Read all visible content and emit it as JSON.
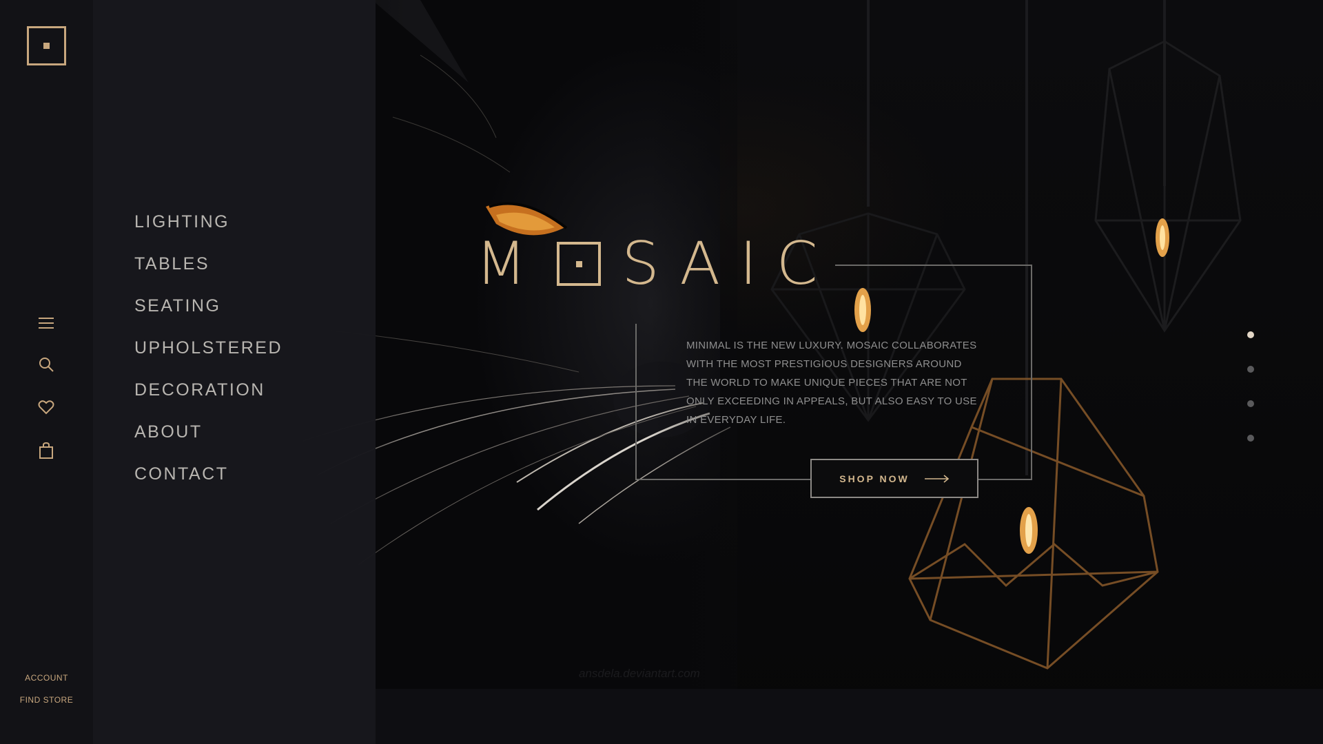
{
  "brand": {
    "name_first": "M",
    "name_rest": "SAIC"
  },
  "sidebar": {
    "icons": [
      "menu-icon",
      "search-icon",
      "heart-icon",
      "shopping-bag-icon"
    ],
    "account_label": "ACCOUNT",
    "find_store_label": "FIND STORE"
  },
  "menu": {
    "items": [
      {
        "label": "LIGHTING"
      },
      {
        "label": "TABLES"
      },
      {
        "label": "SEATING"
      },
      {
        "label": "UPHOLSTERED"
      },
      {
        "label": "DECORATION"
      },
      {
        "label": "ABOUT"
      },
      {
        "label": "CONTACT"
      }
    ]
  },
  "hero": {
    "tagline": "Minimal is the new luxury. Mosaic collaborates with the most prestigious designers around the world to make unique pieces that are not only exceeding in appeals, but also easy to use in everyday life.",
    "cta_label": "SHOP NOW",
    "watermark": "ansdela.deviantart.com"
  },
  "slider": {
    "count": 4,
    "active_index": 0
  },
  "colors": {
    "accent": "#c8a77e",
    "background": "#0a0a0c",
    "menu_panel": "#18181d",
    "text_muted": "#8f8f8f"
  }
}
